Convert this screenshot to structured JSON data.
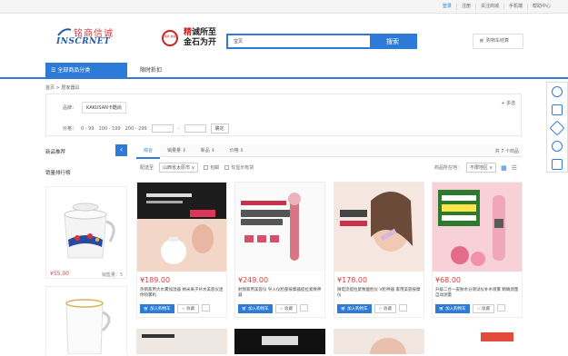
{
  "topbar": {
    "links": [
      "登录",
      "注册",
      "关注商城",
      "手机端",
      "帮助中心"
    ]
  },
  "logo": {
    "cn": "铭商信诚",
    "en": "INSCRNET"
  },
  "seal": {
    "text": "铭商 信诚"
  },
  "slogan": {
    "line1_a": "精",
    "line1_b": "诚所至",
    "line2": "金石为开"
  },
  "search": {
    "value": "宝贝",
    "button": "搜索"
  },
  "cart": {
    "label": "购物车结算"
  },
  "nav": {
    "all_categories": "全部商品分类",
    "link": "限时折扣"
  },
  "breadcrumb": "首页 > 居家器具",
  "filter": {
    "brand_label": "品牌：",
    "brand_value": "KAKUSAN卡酷尚",
    "more": "+ 多选",
    "price_label": "价格：",
    "ranges": [
      "0 - 99",
      "100 - 199",
      "200 - 299"
    ],
    "ok": "确定"
  },
  "sidebar": {
    "new_rec": "新品推荐",
    "sales_rank": "销量排行榜",
    "item1": {
      "price": "¥55.00",
      "sales": "销售量：5"
    }
  },
  "sortbar": {
    "tabs": [
      "综合",
      "销量量 ⇕",
      "新品 ⇕",
      "价格 ⇕"
    ],
    "total": "共 7 个商品"
  },
  "filterbar": {
    "ship_label": "配送至",
    "region": "山西省太原市 ∨",
    "opt1": "包邮",
    "opt2": "仅显示有货",
    "location_label": "商品所在地：",
    "location": "不限地区 ∨"
  },
  "products": [
    {
      "price": "¥189.00",
      "title": "热销家用大水雾加湿器 纳米离子补水美容仪迷你喷雾机",
      "add": "加入购物车",
      "fav": "收藏"
    },
    {
      "price": "¥249.00",
      "title": "射频家用美容仪 导入仪脸部按摩器提拉紧致神器",
      "add": "加入购物车",
      "fav": "收藏"
    },
    {
      "price": "¥178.00",
      "title": "微电流提拉紧致瘦脸仪 V脸神器 家用美容按摩仪",
      "add": "加入购物车",
      "fav": "收藏"
    },
    {
      "price": "¥68.00",
      "title": "升级二合一皮肤水分测试仪补水喷雾 精确测量 自动测量",
      "add": "加入购物车",
      "fav": "收藏"
    }
  ],
  "colors": {
    "accent": "#2d7bd6",
    "price": "#e4393c"
  }
}
